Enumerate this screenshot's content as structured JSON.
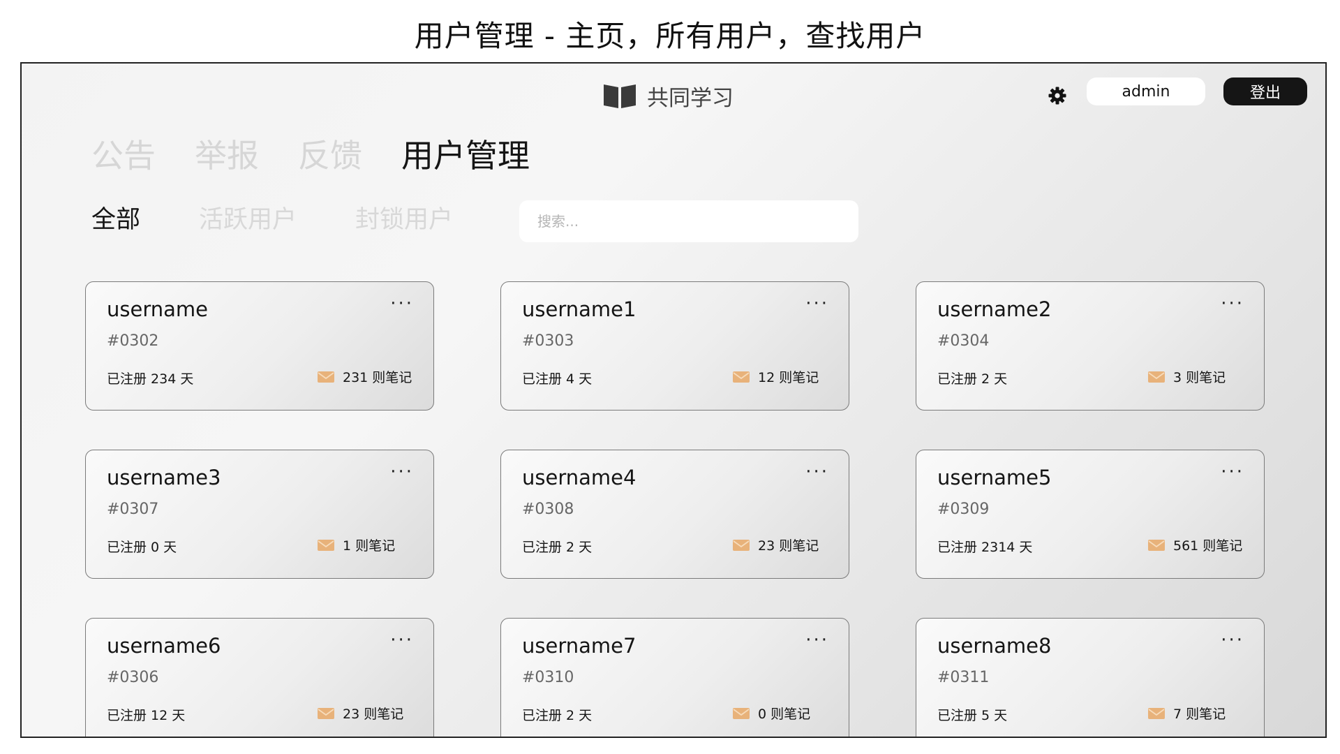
{
  "caption": "用户管理 - 主页，所有用户，查找用户",
  "header": {
    "brand": "共同学习",
    "username": "admin",
    "logout_label": "登出"
  },
  "nav": {
    "items": [
      {
        "label": "公告"
      },
      {
        "label": "举报"
      },
      {
        "label": "反馈"
      },
      {
        "label": "用户管理"
      }
    ],
    "active_index": 3
  },
  "tabs": {
    "items": [
      {
        "label": "全部"
      },
      {
        "label": "活跃用户"
      },
      {
        "label": "封锁用户"
      }
    ],
    "active_index": 0
  },
  "search": {
    "placeholder": "搜索..."
  },
  "more_label": "···",
  "users": [
    {
      "name": "username",
      "id": "#0302",
      "registered": "已注册 234 天",
      "notes": "231 则笔记"
    },
    {
      "name": "username1",
      "id": "#0303",
      "registered": "已注册 4 天",
      "notes": "12 则笔记"
    },
    {
      "name": "username2",
      "id": "#0304",
      "registered": "已注册 2 天",
      "notes": "3 则笔记"
    },
    {
      "name": "username3",
      "id": "#0307",
      "registered": "已注册 0 天",
      "notes": "1 则笔记"
    },
    {
      "name": "username4",
      "id": "#0308",
      "registered": "已注册 2 天",
      "notes": "23 则笔记"
    },
    {
      "name": "username5",
      "id": "#0309",
      "registered": "已注册 2314 天",
      "notes": "561 则笔记"
    },
    {
      "name": "username6",
      "id": "#0306",
      "registered": "已注册 12 天",
      "notes": "23 则笔记"
    },
    {
      "name": "username7",
      "id": "#0310",
      "registered": "已注册 2 天",
      "notes": "0 则笔记"
    },
    {
      "name": "username8",
      "id": "#0311",
      "registered": "已注册 5 天",
      "notes": "7 则笔记"
    }
  ],
  "colors": {
    "accent_dark": "#151515",
    "inactive_text": "#d6d6d6",
    "mail_icon": "#e8b27a"
  }
}
